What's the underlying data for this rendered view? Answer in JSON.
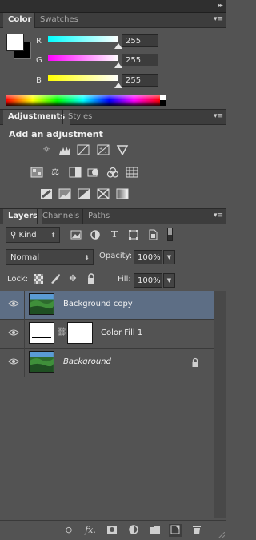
{
  "color_panel": {
    "tabs": [
      {
        "label": "Color"
      },
      {
        "label": "Swatches"
      }
    ],
    "channels": [
      {
        "label": "R",
        "value": "255",
        "level": 1.0
      },
      {
        "label": "G",
        "value": "255",
        "level": 1.0
      },
      {
        "label": "B",
        "value": "255",
        "level": 1.0
      }
    ],
    "foreground_color": "#ffffff",
    "background_color": "#000000"
  },
  "adjustments_panel": {
    "tabs": [
      {
        "label": "Adjustments"
      },
      {
        "label": "Styles"
      }
    ],
    "title": "Add an adjustment",
    "icons_row1": [
      "brightness-contrast-icon",
      "levels-icon",
      "curves-icon",
      "exposure-icon",
      "vibrance-icon"
    ],
    "icons_row2": [
      "hue-saturation-icon",
      "color-balance-icon",
      "black-white-icon",
      "photo-filter-icon",
      "channel-mixer-icon",
      "color-lookup-icon"
    ],
    "icons_row3": [
      "invert-icon",
      "posterize-icon",
      "threshold-icon",
      "selective-color-icon",
      "gradient-map-icon"
    ]
  },
  "layers_panel": {
    "tabs": [
      {
        "label": "Layers"
      },
      {
        "label": "Channels"
      },
      {
        "label": "Paths"
      }
    ],
    "filter_kind": "Kind",
    "blend_mode": "Normal",
    "opacity_label": "Opacity:",
    "opacity_value": "100%",
    "lock_label": "Lock:",
    "fill_label": "Fill:",
    "fill_value": "100%",
    "layers": [
      {
        "name": "Background copy",
        "selected": true,
        "italic": false,
        "locked": false
      },
      {
        "name": "Color Fill 1",
        "selected": false,
        "italic": false,
        "locked": false
      },
      {
        "name": "Background",
        "selected": false,
        "italic": true,
        "locked": true
      }
    ],
    "footer_icons": [
      "link-layers-icon",
      "fx-icon",
      "add-mask-icon",
      "new-adjustment-icon",
      "new-group-icon",
      "new-layer-icon",
      "delete-layer-icon"
    ]
  },
  "colors": {
    "panel_bg": "#535353",
    "selected_row": "#5d6e85",
    "slider_r": "#ffffff",
    "slider_g": "#ff00ff",
    "slider_b": "#ffff00"
  }
}
